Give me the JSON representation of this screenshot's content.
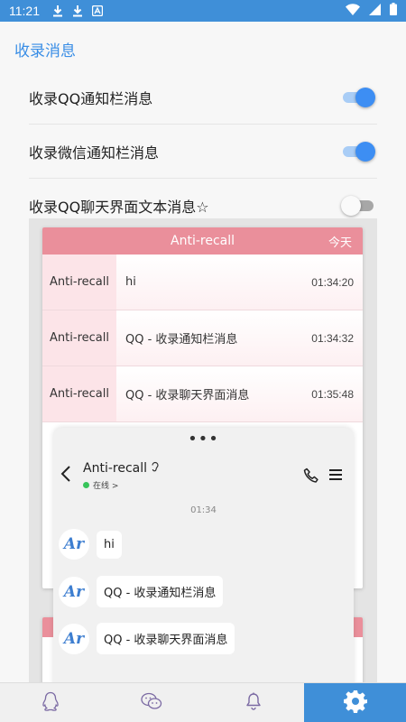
{
  "status": {
    "time": "11:21"
  },
  "section_title": "收录消息",
  "settings": [
    {
      "label": "收录QQ通知栏消息",
      "on": true
    },
    {
      "label": "收录微信通知栏消息",
      "on": true
    },
    {
      "label": "收录QQ聊天界面文本消息☆",
      "on": false
    }
  ],
  "log_card": {
    "title": "Anti-recall",
    "date_label": "今天",
    "rows": [
      {
        "sender": "Anti-recall",
        "text": "hi",
        "time": "01:34:20"
      },
      {
        "sender": "Anti-recall",
        "text": "QQ - 收录通知栏消息",
        "time": "01:34:32"
      },
      {
        "sender": "Anti-recall",
        "text": "QQ - 收录聊天界面消息",
        "time": "01:35:48"
      }
    ]
  },
  "chat": {
    "handle": "•••",
    "contact_name": "Anti-recall",
    "status_text": "在线 >",
    "timestamp": "01:34",
    "avatar_text": "Ar",
    "messages": [
      "hi",
      "QQ - 收录通知栏消息",
      "QQ - 收录聊天界面消息"
    ]
  },
  "colors": {
    "accent": "#3f8fd8",
    "pink": "#ea8f9b",
    "toggle_on": "#3d8ef3"
  },
  "nav": [
    {
      "icon": "qq-penguin-icon",
      "active": false
    },
    {
      "icon": "chat-bubbles-icon",
      "active": false
    },
    {
      "icon": "bell-icon",
      "active": false
    },
    {
      "icon": "gear-icon",
      "active": true
    }
  ]
}
